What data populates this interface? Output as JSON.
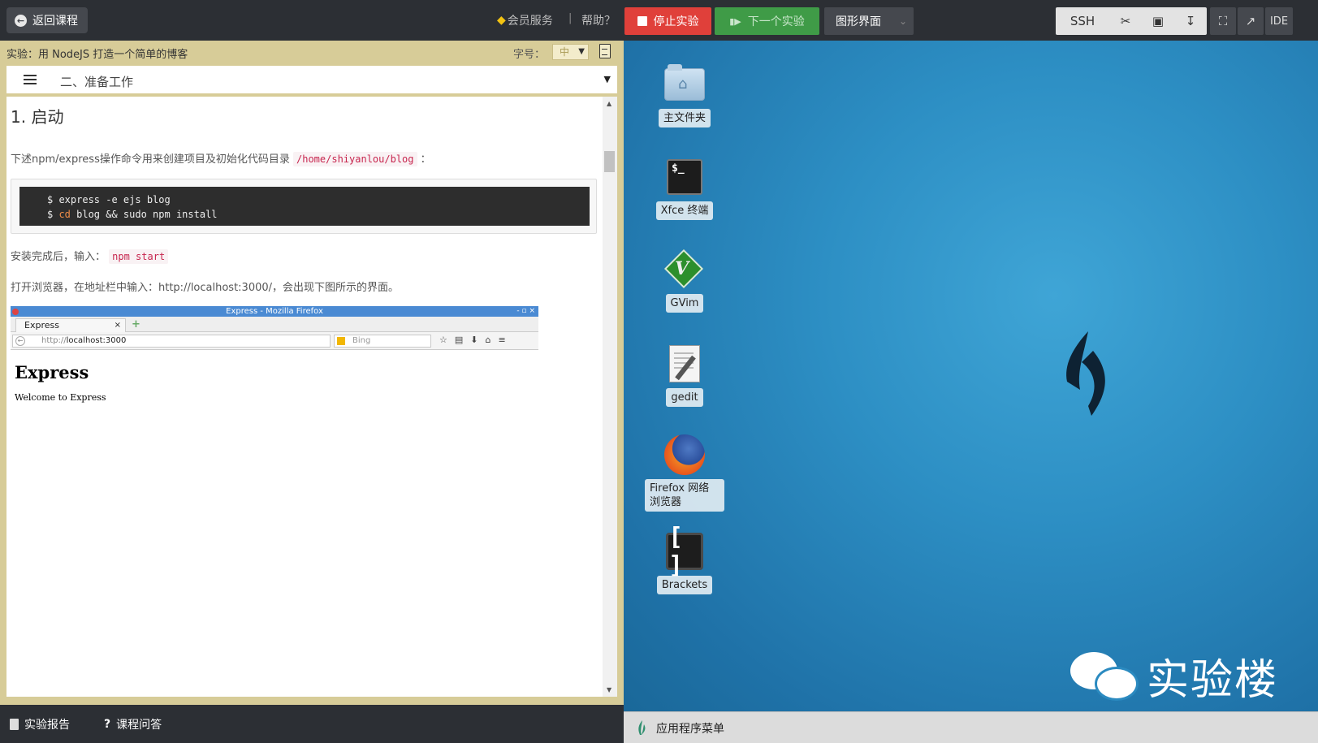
{
  "topbar": {
    "back_label": "返回课程",
    "member_label": "会员服务",
    "separator": "|",
    "help_label": "帮助？",
    "stop_label": "停止实验",
    "next_label": "下一个实验",
    "gui_label": "图形界面",
    "ssh_label": "SSH",
    "ide_label": "IDE"
  },
  "lesson": {
    "title": "实验：用 NodeJS 打造一个简单的博客",
    "font_size_label": "字号：",
    "font_size_value": "中",
    "toc_current": "二、准备工作"
  },
  "content": {
    "heading": "1. 启动",
    "para1": "下述npm/express操作命令用来创建项目及初始化代码目录",
    "para1_code": "/home/shiyanlou/blog",
    "para1_tail": "：",
    "code_line1": "$ express -e ejs blog",
    "code_line2_prompt": "$ ",
    "code_line2_kw": "cd",
    "code_line2_rest": " blog && sudo npm install",
    "para2": "安装完成后，输入：",
    "para2_code": "npm start",
    "para3": "打开浏览器，在地址栏中输入：http://localhost:3000/，会出现下图所示的界面。"
  },
  "screenshot": {
    "window_title": "Express - Mozilla Firefox",
    "tab_label": "Express",
    "tab_close": "×",
    "url_prefix": "http://",
    "url_host": "localhost:3000",
    "search_placeholder": "Bing",
    "page_heading": "Express",
    "page_text": "Welcome to Express"
  },
  "footer": {
    "report_label": "实验报告",
    "qa_label": "课程问答"
  },
  "desktop": {
    "icons": [
      {
        "label": "主文件夹",
        "icon": "home-folder-icon"
      },
      {
        "label": "Xfce 终端",
        "icon": "terminal-icon"
      },
      {
        "label": "GVim",
        "icon": "gvim-icon"
      },
      {
        "label": "gedit",
        "icon": "gedit-icon"
      },
      {
        "label": "Firefox 网络浏览器",
        "icon": "firefox-icon"
      },
      {
        "label": "Brackets",
        "icon": "brackets-icon"
      }
    ],
    "terminal_glyph": "$_",
    "brackets_glyph": "[ ]",
    "brand_text": "实验楼",
    "app_menu_label": "应用程序菜单"
  },
  "colors": {
    "stop": "#e0403a",
    "next": "#3f9b47",
    "panel_bg": "#d7cc98",
    "desktop": "#2d8fc4"
  }
}
